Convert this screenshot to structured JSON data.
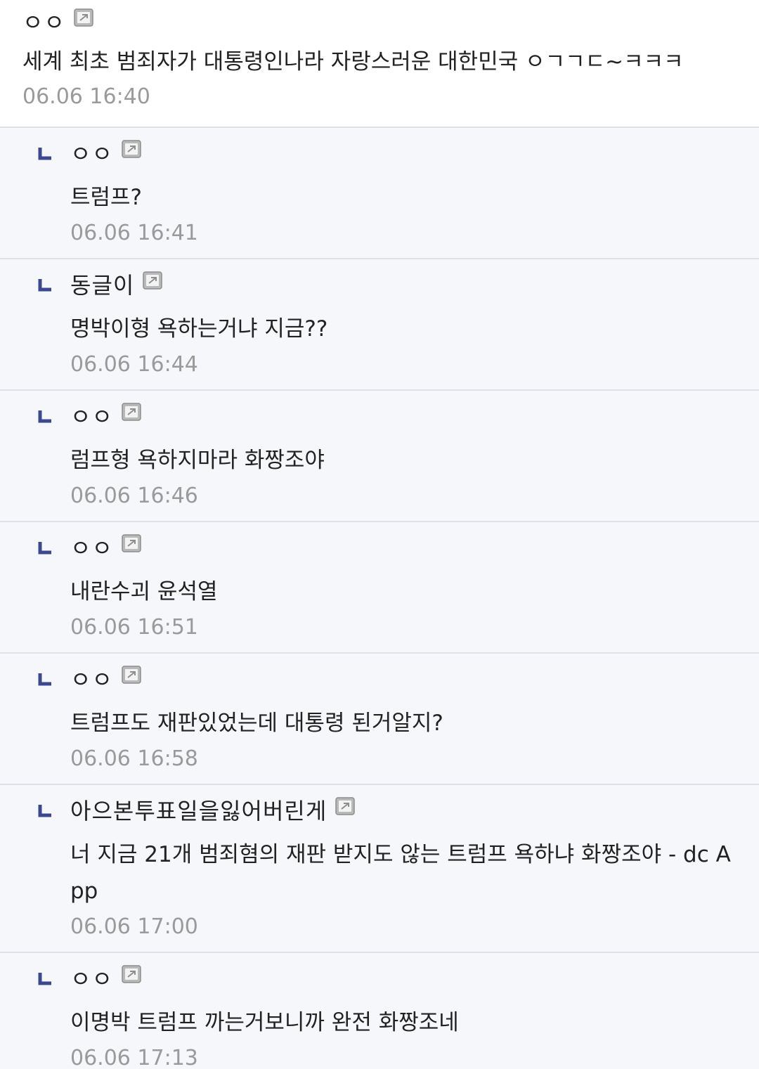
{
  "comments": [
    {
      "nick": "ㅇㅇ",
      "text": "세계 최초 범죄자가 대통령인나라 자랑스러운 대한민국 ㅇㄱㄱㄷ~ㅋㅋㅋ",
      "time": "06.06 16:40"
    }
  ],
  "replies": [
    {
      "nick": "ㅇㅇ",
      "text": "트럼프?",
      "time": "06.06 16:41"
    },
    {
      "nick": "동글이",
      "text": "명박이형 욕하는거냐 지금??",
      "time": "06.06 16:44"
    },
    {
      "nick": "ㅇㅇ",
      "text": "럼프형 욕하지마라 화짱조야",
      "time": "06.06 16:46"
    },
    {
      "nick": "ㅇㅇ",
      "text": "내란수괴 윤석열",
      "time": "06.06 16:51"
    },
    {
      "nick": "ㅇㅇ",
      "text": "트럼프도 재판있었는데 대통령 된거알지?",
      "time": "06.06 16:58"
    },
    {
      "nick": "아으본투표일을잃어버린게",
      "text": "너 지금 21개 범죄혐의 재판 받지도 않는 트럼프 욕하냐 화짱조야 - dc App",
      "time": "06.06 17:00"
    },
    {
      "nick": "ㅇㅇ",
      "text": "이명박 트럼프 까는거보니까 완전 화짱조네",
      "time": "06.06 17:13"
    }
  ],
  "icons": {
    "reply_arrow": "reply-arrow-icon",
    "fixed_nick": "fixed-nick-icon"
  },
  "colors": {
    "reply_background": "#f6f7fa",
    "divider": "#dfe1e7",
    "timestamp": "#9a9a9a",
    "reply_arrow": "#3b4890"
  }
}
